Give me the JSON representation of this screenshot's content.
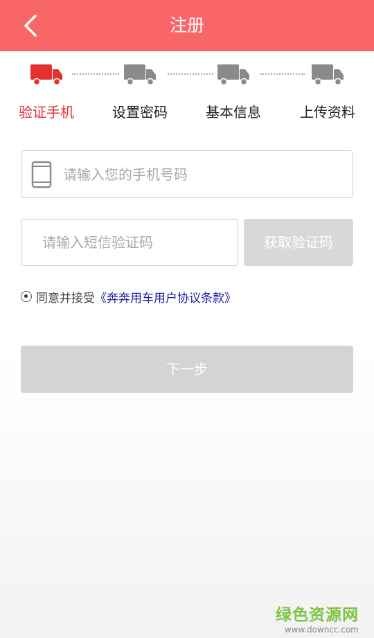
{
  "header": {
    "title": "注册"
  },
  "steps": [
    {
      "label": "验证手机",
      "active": true
    },
    {
      "label": "设置密码",
      "active": false
    },
    {
      "label": "基本信息",
      "active": false
    },
    {
      "label": "上传资料",
      "active": false
    }
  ],
  "form": {
    "phone_placeholder": "请输入您的手机号码",
    "code_placeholder": "请输入短信验证码",
    "get_code_label": "获取验证码",
    "agree_text": "同意并接受",
    "agree_link": "《奔奔用车用户协议条款》",
    "next_label": "下一步"
  },
  "watermark": {
    "title": "绿色资源网",
    "url": "www.downcc.com"
  },
  "colors": {
    "header": "#f86667",
    "active_step": "#e2312f",
    "inactive_truck": "#8a8a8a",
    "link": "#1b1ba0",
    "disabled_button": "#d4d4d4"
  }
}
